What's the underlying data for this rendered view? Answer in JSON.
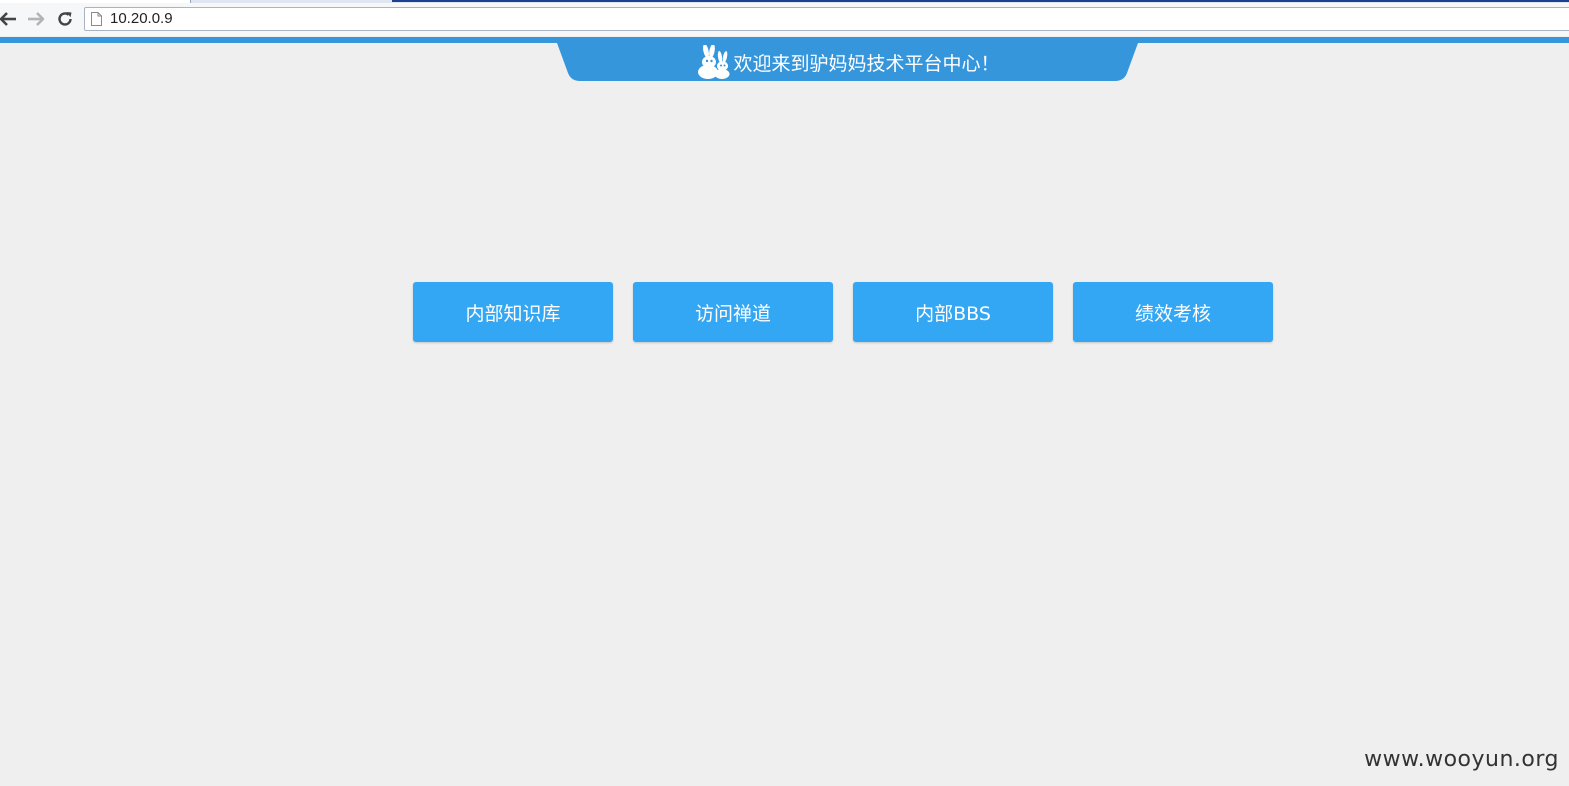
{
  "browser": {
    "url": "10.20.0.9",
    "icons": {
      "back": "back-arrow-icon",
      "forward": "forward-arrow-icon",
      "reload": "reload-icon",
      "page": "page-icon"
    }
  },
  "header": {
    "title": "欢迎来到驴妈妈技术平台中心！",
    "logo": "rabbit-logo",
    "color": "#3596dc"
  },
  "nav_buttons": [
    {
      "label": "内部知识库"
    },
    {
      "label": "访问禅道"
    },
    {
      "label": "内部BBS"
    },
    {
      "label": "绩效考核"
    }
  ],
  "button_color": "#33a6f4",
  "watermark": "www.wooyun.org"
}
